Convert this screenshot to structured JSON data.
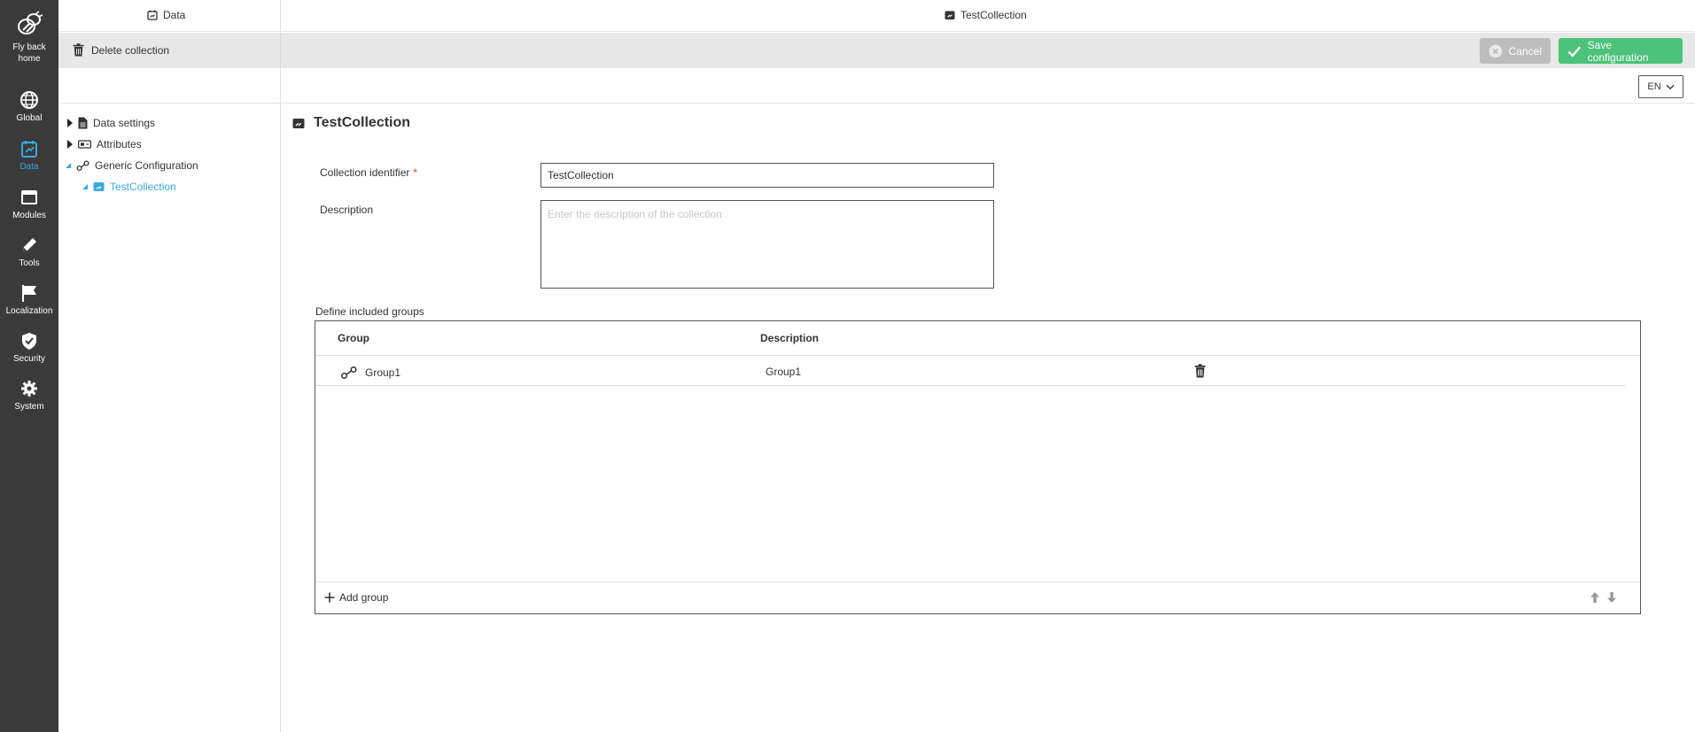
{
  "nav": {
    "items": [
      {
        "label": "Fly back home",
        "icon": "bee-logo-icon",
        "active": false
      },
      {
        "label": "Global",
        "icon": "globe-icon",
        "active": false
      },
      {
        "label": "Data",
        "icon": "data-icon",
        "active": true
      },
      {
        "label": "Modules",
        "icon": "modules-icon",
        "active": false
      },
      {
        "label": "Tools",
        "icon": "pencil-icon",
        "active": false
      },
      {
        "label": "Localization",
        "icon": "flag-icon",
        "active": false
      },
      {
        "label": "Security",
        "icon": "shield-icon",
        "active": false
      },
      {
        "label": "System",
        "icon": "gear-icon",
        "active": false
      }
    ],
    "fly_back_line1": "Fly back",
    "fly_back_line2": "home"
  },
  "header": {
    "left_tab": "Data",
    "right_tab": "TestCollection"
  },
  "toolbar": {
    "delete_label": "Delete collection",
    "cancel_label": "Cancel",
    "save_label": "Save configuration"
  },
  "language": "EN",
  "tree": {
    "items": [
      {
        "label": "Data settings",
        "icon": "document-icon"
      },
      {
        "label": "Attributes",
        "icon": "attributes-icon"
      },
      {
        "label": "Generic Configuration",
        "icon": "link-icon"
      },
      {
        "label": "TestCollection",
        "icon": "collection-icon",
        "selected": true
      }
    ]
  },
  "main": {
    "title": "TestCollection",
    "identifier_label": "Collection identifier",
    "required_marker": "*",
    "identifier_value": "TestCollection",
    "description_label": "Description",
    "description_placeholder": "Enter the description of the collection",
    "groups_label": "Define included groups",
    "columns": [
      "Group",
      "Description"
    ],
    "rows": [
      {
        "group": "Group1",
        "description": "Group1"
      }
    ],
    "add_group_label": "Add group"
  },
  "colors": {
    "rail_bg": "#3a3a3a",
    "accent": "#39a9e0",
    "save_green": "#4cc27a",
    "cancel_gray": "#bdbdbd"
  }
}
